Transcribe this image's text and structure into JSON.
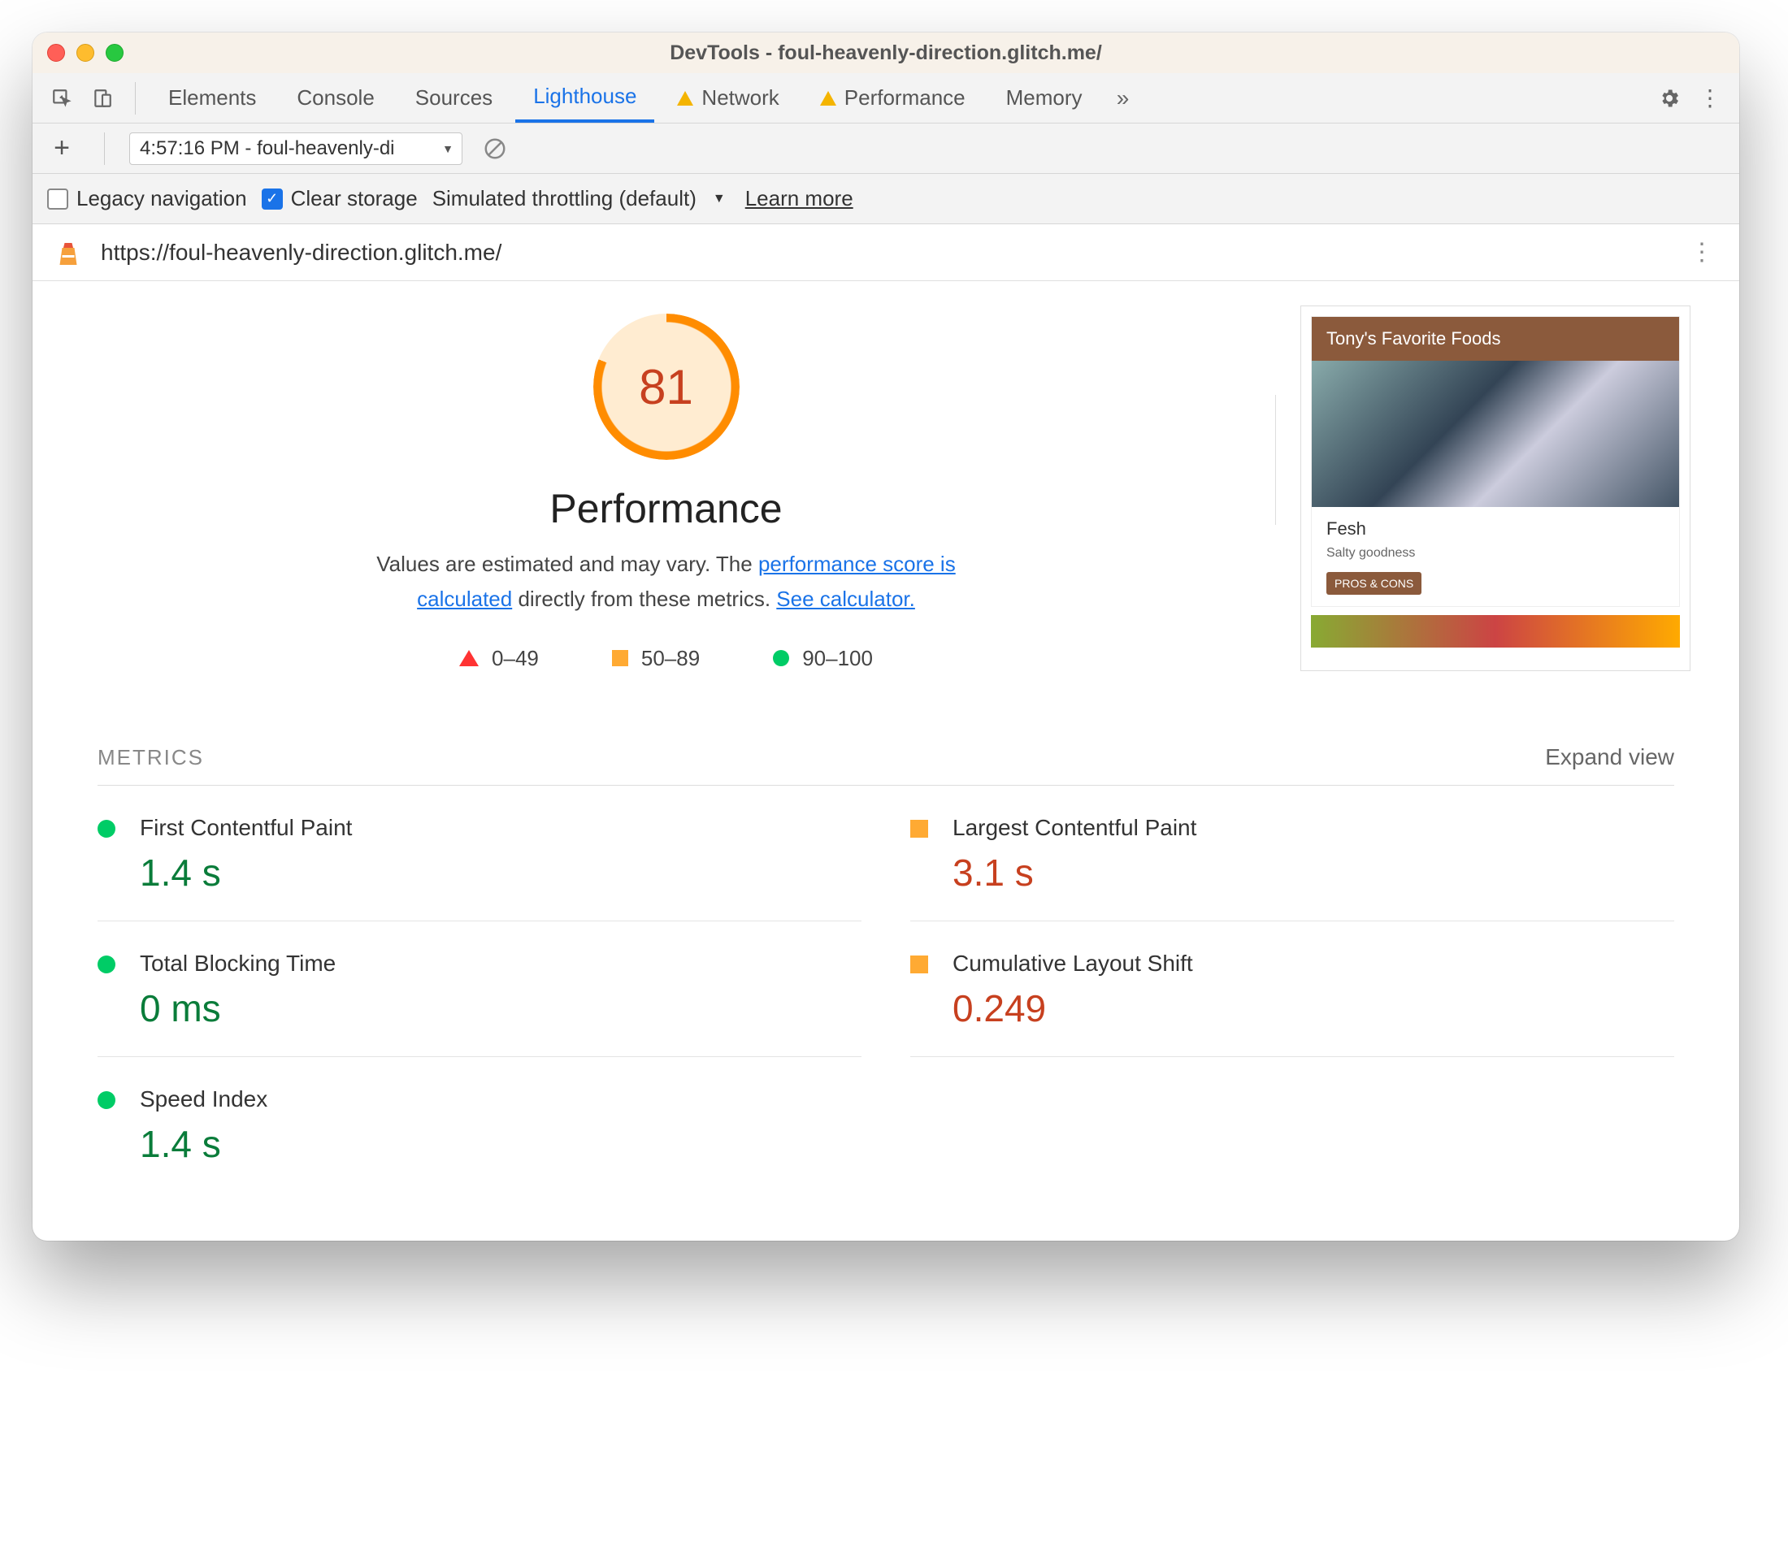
{
  "window": {
    "title": "DevTools - foul-heavenly-direction.glitch.me/"
  },
  "tabs": {
    "items": [
      "Elements",
      "Console",
      "Sources",
      "Lighthouse",
      "Network",
      "Performance",
      "Memory"
    ],
    "active": "Lighthouse",
    "warn": [
      "Network",
      "Performance"
    ]
  },
  "subbar": {
    "report_label": "4:57:16 PM - foul-heavenly-di"
  },
  "options": {
    "legacy_label": "Legacy navigation",
    "legacy_checked": false,
    "clear_label": "Clear storage",
    "clear_checked": true,
    "throttling_label": "Simulated throttling (default)",
    "learn_label": "Learn more"
  },
  "url_row": {
    "url": "https://foul-heavenly-direction.glitch.me/"
  },
  "gauge": {
    "score": "81",
    "category": "Performance"
  },
  "desc": {
    "t1": "Values are estimated and may vary. The ",
    "link1": "performance score is calculated",
    "t2": " directly from these metrics. ",
    "link2": "See calculator."
  },
  "legend": {
    "r": "0–49",
    "o": "50–89",
    "g": "90–100"
  },
  "preview": {
    "header": "Tony's Favorite Foods",
    "title": "Fesh",
    "sub": "Salty goodness",
    "btn": "PROS & CONS"
  },
  "metrics": {
    "title": "METRICS",
    "expand": "Expand view",
    "items": [
      {
        "label": "First Contentful Paint",
        "value": "1.4 s",
        "status": "good"
      },
      {
        "label": "Largest Contentful Paint",
        "value": "3.1 s",
        "status": "avg"
      },
      {
        "label": "Total Blocking Time",
        "value": "0 ms",
        "status": "good"
      },
      {
        "label": "Cumulative Layout Shift",
        "value": "0.249",
        "status": "avg"
      },
      {
        "label": "Speed Index",
        "value": "1.4 s",
        "status": "good"
      }
    ]
  }
}
